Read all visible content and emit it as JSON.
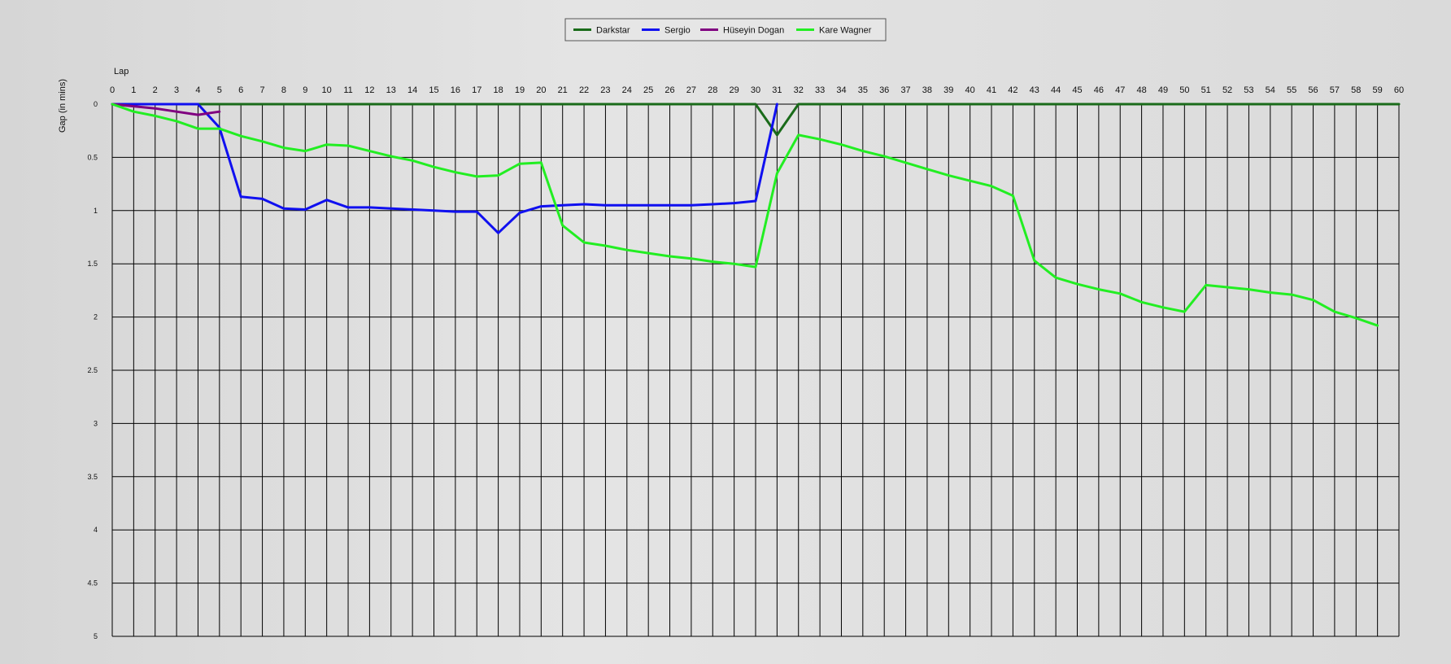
{
  "chart_data": {
    "type": "line",
    "xlabel": "Lap",
    "ylabel": "Gap (in mins)",
    "xlim": [
      0,
      60
    ],
    "ylim": [
      0,
      5
    ],
    "y_inverted": true,
    "grid": true,
    "legend_position": "top-center",
    "x_ticks": [
      0,
      1,
      2,
      3,
      4,
      5,
      6,
      7,
      8,
      9,
      10,
      11,
      12,
      13,
      14,
      15,
      16,
      17,
      18,
      19,
      20,
      21,
      22,
      23,
      24,
      25,
      26,
      27,
      28,
      29,
      30,
      31,
      32,
      33,
      34,
      35,
      36,
      37,
      38,
      39,
      40,
      41,
      42,
      43,
      44,
      45,
      46,
      47,
      48,
      49,
      50,
      51,
      52,
      53,
      54,
      55,
      56,
      57,
      58,
      59,
      60
    ],
    "y_ticks": [
      {
        "value": 0,
        "label": "0"
      },
      {
        "value": 0.5,
        "label": "0.5"
      },
      {
        "value": 1,
        "label": "1"
      },
      {
        "value": 1.5,
        "label": "1.5"
      },
      {
        "value": 2,
        "label": "2"
      },
      {
        "value": 2.5,
        "label": "2.5"
      },
      {
        "value": 3,
        "label": "3"
      },
      {
        "value": 3.5,
        "label": "3.5"
      },
      {
        "value": 4,
        "label": "4"
      },
      {
        "value": 4.5,
        "label": "4.5"
      },
      {
        "value": 5,
        "label": "5"
      }
    ],
    "series": [
      {
        "name": "Darkstar",
        "color": "#1a6b1a",
        "x": [
          0,
          1,
          2,
          3,
          4,
          5,
          6,
          7,
          8,
          9,
          10,
          11,
          12,
          13,
          14,
          15,
          16,
          17,
          18,
          19,
          20,
          21,
          22,
          23,
          24,
          25,
          26,
          27,
          28,
          29,
          30,
          31,
          32,
          33,
          34,
          35,
          36,
          37,
          38,
          39,
          40,
          41,
          42,
          43,
          44,
          45,
          46,
          47,
          48,
          49,
          50,
          51,
          52,
          53,
          54,
          55,
          56,
          57,
          58,
          59,
          60
        ],
        "y": [
          0,
          0,
          0,
          0,
          0,
          0,
          0,
          0,
          0,
          0,
          0,
          0,
          0,
          0,
          0,
          0,
          0,
          0,
          0,
          0,
          0,
          0,
          0,
          0,
          0,
          0,
          0,
          0,
          0,
          0,
          0,
          0.29,
          0,
          0,
          0,
          0,
          0,
          0,
          0,
          0,
          0,
          0,
          0,
          0,
          0,
          0,
          0,
          0,
          0,
          0,
          0,
          0,
          0,
          0,
          0,
          0,
          0,
          0,
          0,
          0,
          0
        ]
      },
      {
        "name": "Sergio",
        "color": "#1010f0",
        "x": [
          0,
          1,
          2,
          3,
          4,
          5,
          6,
          7,
          8,
          9,
          10,
          11,
          12,
          13,
          14,
          15,
          16,
          17,
          18,
          19,
          20,
          21,
          22,
          23,
          24,
          25,
          26,
          27,
          28,
          29,
          30,
          31
        ],
        "y": [
          0,
          0,
          0,
          0,
          0,
          0.22,
          0.87,
          0.89,
          0.98,
          0.99,
          0.9,
          0.97,
          0.97,
          0.98,
          0.99,
          1.0,
          1.01,
          1.01,
          1.21,
          1.02,
          0.96,
          0.95,
          0.94,
          0.95,
          0.95,
          0.95,
          0.95,
          0.95,
          0.94,
          0.93,
          0.91,
          0
        ]
      },
      {
        "name": "Hüseyin  Dogan",
        "color": "#800080",
        "x": [
          0,
          1,
          2,
          3,
          4,
          5
        ],
        "y": [
          0,
          0.02,
          0.04,
          0.07,
          0.1,
          0.07
        ]
      },
      {
        "name": "Kare Wagner",
        "color": "#22ee22",
        "x": [
          0,
          1,
          2,
          3,
          4,
          5,
          6,
          7,
          8,
          9,
          10,
          11,
          12,
          13,
          14,
          15,
          16,
          17,
          18,
          19,
          20,
          21,
          22,
          23,
          24,
          25,
          26,
          27,
          28,
          29,
          30,
          31,
          32,
          33,
          34,
          35,
          36,
          37,
          38,
          39,
          40,
          41,
          42,
          43,
          44,
          45,
          46,
          47,
          48,
          49,
          50,
          51,
          52,
          53,
          54,
          55,
          56,
          57,
          58,
          59
        ],
        "y": [
          0,
          0.07,
          0.11,
          0.16,
          0.23,
          0.23,
          0.3,
          0.35,
          0.41,
          0.44,
          0.38,
          0.39,
          0.44,
          0.49,
          0.53,
          0.59,
          0.64,
          0.68,
          0.67,
          0.56,
          0.55,
          1.14,
          1.3,
          1.33,
          1.37,
          1.4,
          1.43,
          1.45,
          1.48,
          1.5,
          1.53,
          0.65,
          0.29,
          0.33,
          0.38,
          0.44,
          0.49,
          0.55,
          0.61,
          0.67,
          0.72,
          0.77,
          0.86,
          1.47,
          1.63,
          1.69,
          1.74,
          1.78,
          1.86,
          1.91,
          1.95,
          1.7,
          1.72,
          1.74,
          1.77,
          1.79,
          1.84,
          1.95,
          2.01,
          2.08
        ]
      }
    ]
  }
}
